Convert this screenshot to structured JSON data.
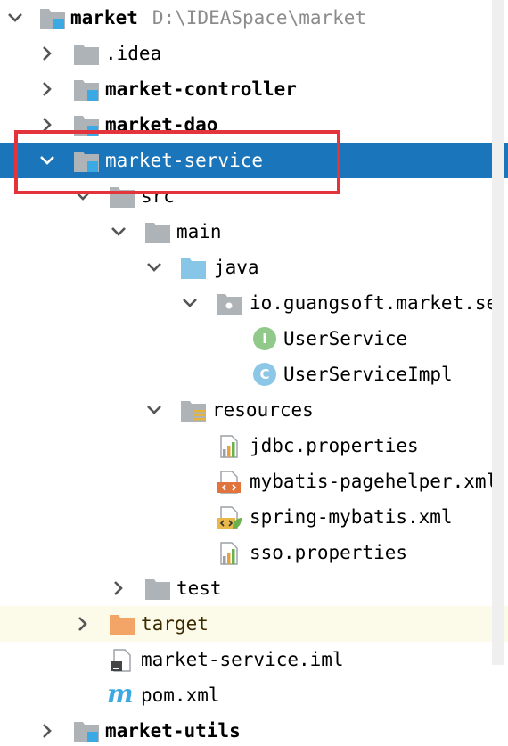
{
  "project": {
    "name": "market",
    "path": "D:\\IDEASpace\\market"
  },
  "items": {
    "idea": ".idea",
    "controller": "market-controller",
    "dao": "market-dao",
    "service": "market-service",
    "src": "src",
    "main": "main",
    "java": "java",
    "package": "io.guangsoft.market.se",
    "user_service": "UserService",
    "user_service_impl": "UserServiceImpl",
    "resources": "resources",
    "jdbc": "jdbc.properties",
    "pagehelper": "mybatis-pagehelper.xml",
    "spring_mybatis": "spring-mybatis.xml",
    "sso": "sso.properties",
    "test": "test",
    "target": "target",
    "iml": "market-service.iml",
    "pom": "pom.xml",
    "utils": "market-utils"
  },
  "badges": {
    "interface_letter": "I",
    "class_letter": "C"
  },
  "colors": {
    "selection": "#1a75ba",
    "highlight_box": "#e3343b",
    "folder": "#aeb3b8",
    "source_folder": "#87c6e6",
    "excluded_folder": "#f2a566",
    "module_badge": "#3ba9e3",
    "interface_badge": "#91c98a",
    "class_badge": "#8cc7e8"
  },
  "icons": {
    "module": "module-folder-icon",
    "folder": "folder-icon",
    "source_root": "source-root-folder-icon",
    "package": "package-icon",
    "resources": "resources-folder-icon",
    "excluded": "excluded-folder-icon",
    "properties": "properties-file-icon",
    "xml": "xml-file-icon",
    "spring_xml": "spring-xml-file-icon",
    "iml": "iml-file-icon",
    "maven": "maven-pom-icon"
  }
}
